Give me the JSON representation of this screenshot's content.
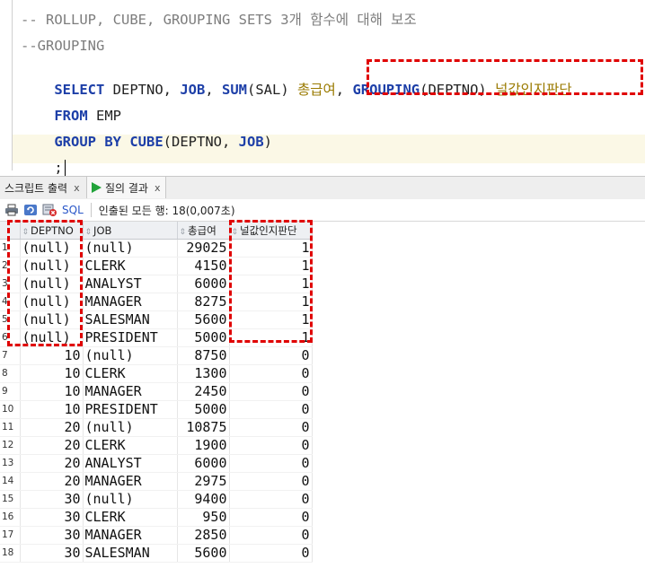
{
  "editor": {
    "comment1": "-- ROLLUP, CUBE, GROUPING SETS 3개 함수에 대해 보조",
    "comment2": "--GROUPING",
    "select_kw": "SELECT",
    "select_cols": " DEPTNO, ",
    "job_kw": "JOB",
    "comma_sum": ", ",
    "sum_kw": "SUM",
    "sum_arg": "(SAL) ",
    "alias1": "총급여",
    "comma2": ", ",
    "grouping_kw": "GROUPING",
    "grouping_arg": "(DEPTNO) ",
    "alias2": "널값인지판단",
    "from_kw": "FROM",
    "from_table": " EMP",
    "group_kw": "GROUP BY",
    "cube_kw": "CUBE",
    "cube_arg1": "(DEPTNO, ",
    "cube_job": "JOB",
    "cube_close": ")",
    "terminator": ";"
  },
  "tabs": [
    {
      "label": "스크립트 출력",
      "close": "x"
    },
    {
      "label": "질의 결과",
      "close": "x"
    }
  ],
  "toolbar": {
    "sql_label": "SQL",
    "status": "인출된 모든 행: 18(0,007초)"
  },
  "grid": {
    "headers": [
      "DEPTNO",
      "JOB",
      "총급여",
      "널값인지판단"
    ],
    "rows": [
      {
        "n": "1",
        "deptno": "(null)",
        "job": "(null)",
        "sal": "29025",
        "grp": "1"
      },
      {
        "n": "2",
        "deptno": "(null)",
        "job": "CLERK",
        "sal": "4150",
        "grp": "1"
      },
      {
        "n": "3",
        "deptno": "(null)",
        "job": "ANALYST",
        "sal": "6000",
        "grp": "1"
      },
      {
        "n": "4",
        "deptno": "(null)",
        "job": "MANAGER",
        "sal": "8275",
        "grp": "1"
      },
      {
        "n": "5",
        "deptno": "(null)",
        "job": "SALESMAN",
        "sal": "5600",
        "grp": "1"
      },
      {
        "n": "6",
        "deptno": "(null)",
        "job": "PRESIDENT",
        "sal": "5000",
        "grp": "1"
      },
      {
        "n": "7",
        "deptno": "10",
        "job": "(null)",
        "sal": "8750",
        "grp": "0"
      },
      {
        "n": "8",
        "deptno": "10",
        "job": "CLERK",
        "sal": "1300",
        "grp": "0"
      },
      {
        "n": "9",
        "deptno": "10",
        "job": "MANAGER",
        "sal": "2450",
        "grp": "0"
      },
      {
        "n": "10",
        "deptno": "10",
        "job": "PRESIDENT",
        "sal": "5000",
        "grp": "0"
      },
      {
        "n": "11",
        "deptno": "20",
        "job": "(null)",
        "sal": "10875",
        "grp": "0"
      },
      {
        "n": "12",
        "deptno": "20",
        "job": "CLERK",
        "sal": "1900",
        "grp": "0"
      },
      {
        "n": "13",
        "deptno": "20",
        "job": "ANALYST",
        "sal": "6000",
        "grp": "0"
      },
      {
        "n": "14",
        "deptno": "20",
        "job": "MANAGER",
        "sal": "2975",
        "grp": "0"
      },
      {
        "n": "15",
        "deptno": "30",
        "job": "(null)",
        "sal": "9400",
        "grp": "0"
      },
      {
        "n": "16",
        "deptno": "30",
        "job": "CLERK",
        "sal": "950",
        "grp": "0"
      },
      {
        "n": "17",
        "deptno": "30",
        "job": "MANAGER",
        "sal": "2850",
        "grp": "0"
      },
      {
        "n": "18",
        "deptno": "30",
        "job": "SALESMAN",
        "sal": "5600",
        "grp": "0"
      }
    ]
  },
  "colors": {
    "keyword": "#1d3fa8",
    "comment": "#7d7d7d",
    "korean_alias": "#9a7a00",
    "highlight_box": "#e00000"
  }
}
